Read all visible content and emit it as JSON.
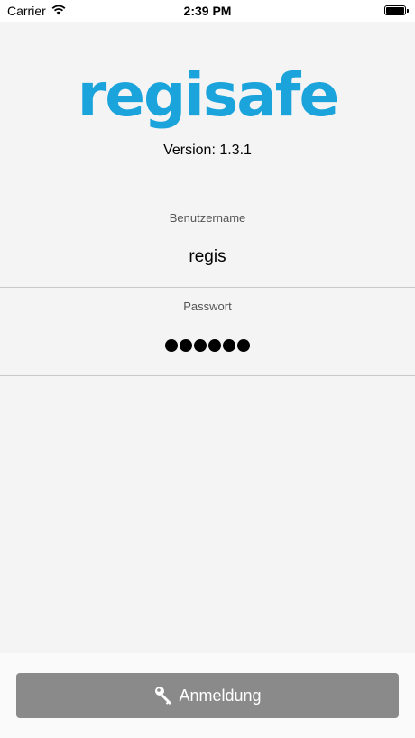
{
  "status_bar": {
    "carrier": "Carrier",
    "time": "2:39 PM",
    "wifi_icon": "wifi-icon",
    "battery_icon": "battery-icon"
  },
  "logo": {
    "text": "regisafe",
    "color": "#1ba4dc"
  },
  "version": "Version: 1.3.1",
  "form": {
    "username_label": "Benutzername",
    "username_value": "regis",
    "password_label": "Passwort",
    "password_length": 6
  },
  "login_button": {
    "label": "Anmeldung",
    "icon": "key-icon",
    "color": "#8a8a8a"
  }
}
